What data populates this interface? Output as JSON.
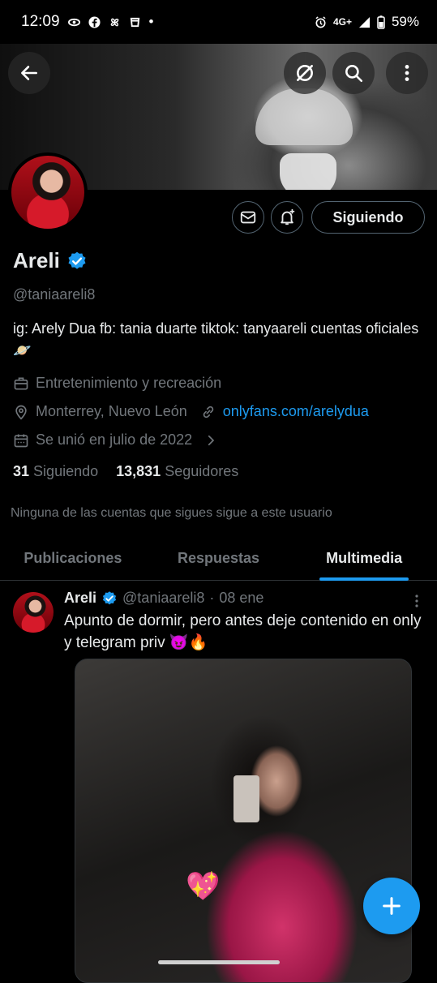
{
  "status_bar": {
    "time": "12:09",
    "dot": "•",
    "network": "4G+",
    "battery": "59%"
  },
  "profile": {
    "name": "Areli",
    "handle": "@taniaareli8",
    "bio": "ig: Arely Dua fb: tania duarte tiktok: tanyaareli cuentas oficiales 🪐",
    "category": "Entretenimiento y recreación",
    "location": "Monterrey, Nuevo León",
    "link": "onlyfans.com/arelydua",
    "joined": "Se unió en julio de 2022",
    "following_count": "31",
    "following_label": "Siguiendo",
    "followers_count": "13,831",
    "followers_label": "Seguidores",
    "follow_button": "Siguiendo",
    "mutuals_note": "Ninguna de las cuentas que sigues sigue a este usuario"
  },
  "tabs": [
    {
      "label": "Publicaciones"
    },
    {
      "label": "Respuestas"
    },
    {
      "label": "Multimedia",
      "active": true
    }
  ],
  "post": {
    "name": "Areli",
    "handle": "@taniaareli8",
    "sep": "·",
    "date": "08 ene",
    "text": "Apunto de dormir, pero antes deje contenido en only y telegram priv 😈🔥"
  },
  "colors": {
    "accent": "#1d9bf0",
    "muted": "#71767b",
    "background": "#000000"
  }
}
